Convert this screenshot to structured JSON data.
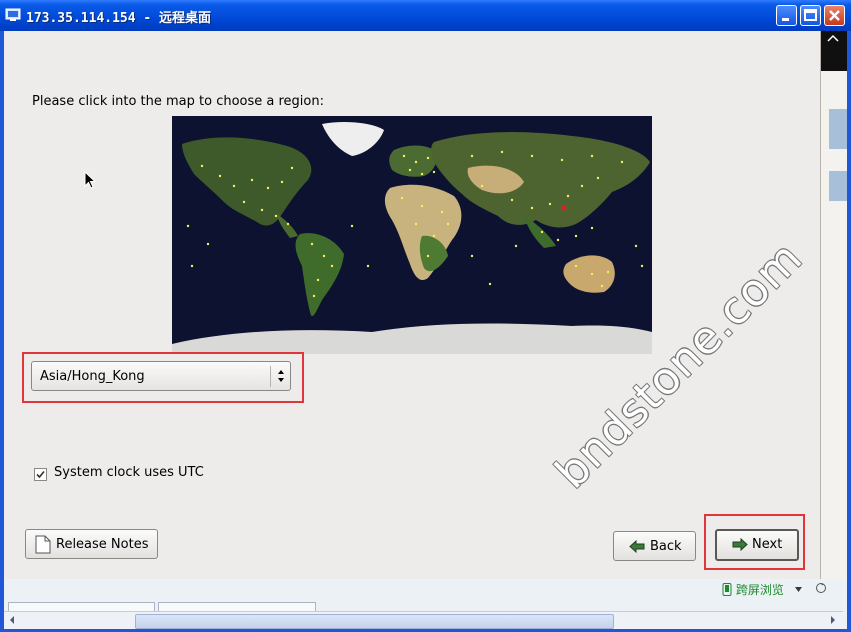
{
  "window": {
    "title": "173.35.114.154 - 远程桌面",
    "buttons": [
      "minimize-icon",
      "maximize-icon",
      "close-icon"
    ]
  },
  "installer": {
    "prompt": "Please click into the map to choose a region:",
    "timezone_value": "Asia/Hong_Kong",
    "utc_checkbox": {
      "label": "System clock uses UTC",
      "checked": true
    },
    "buttons": {
      "release_notes": "Release Notes",
      "back": "Back",
      "next": "Next"
    }
  },
  "watermark": "bndstone.com",
  "statusbar": {
    "text": "跨屏浏览"
  },
  "colors": {
    "titlebar": "#0049d8",
    "highlight_box": "#e0353b",
    "status_text": "#1b8a2b"
  }
}
